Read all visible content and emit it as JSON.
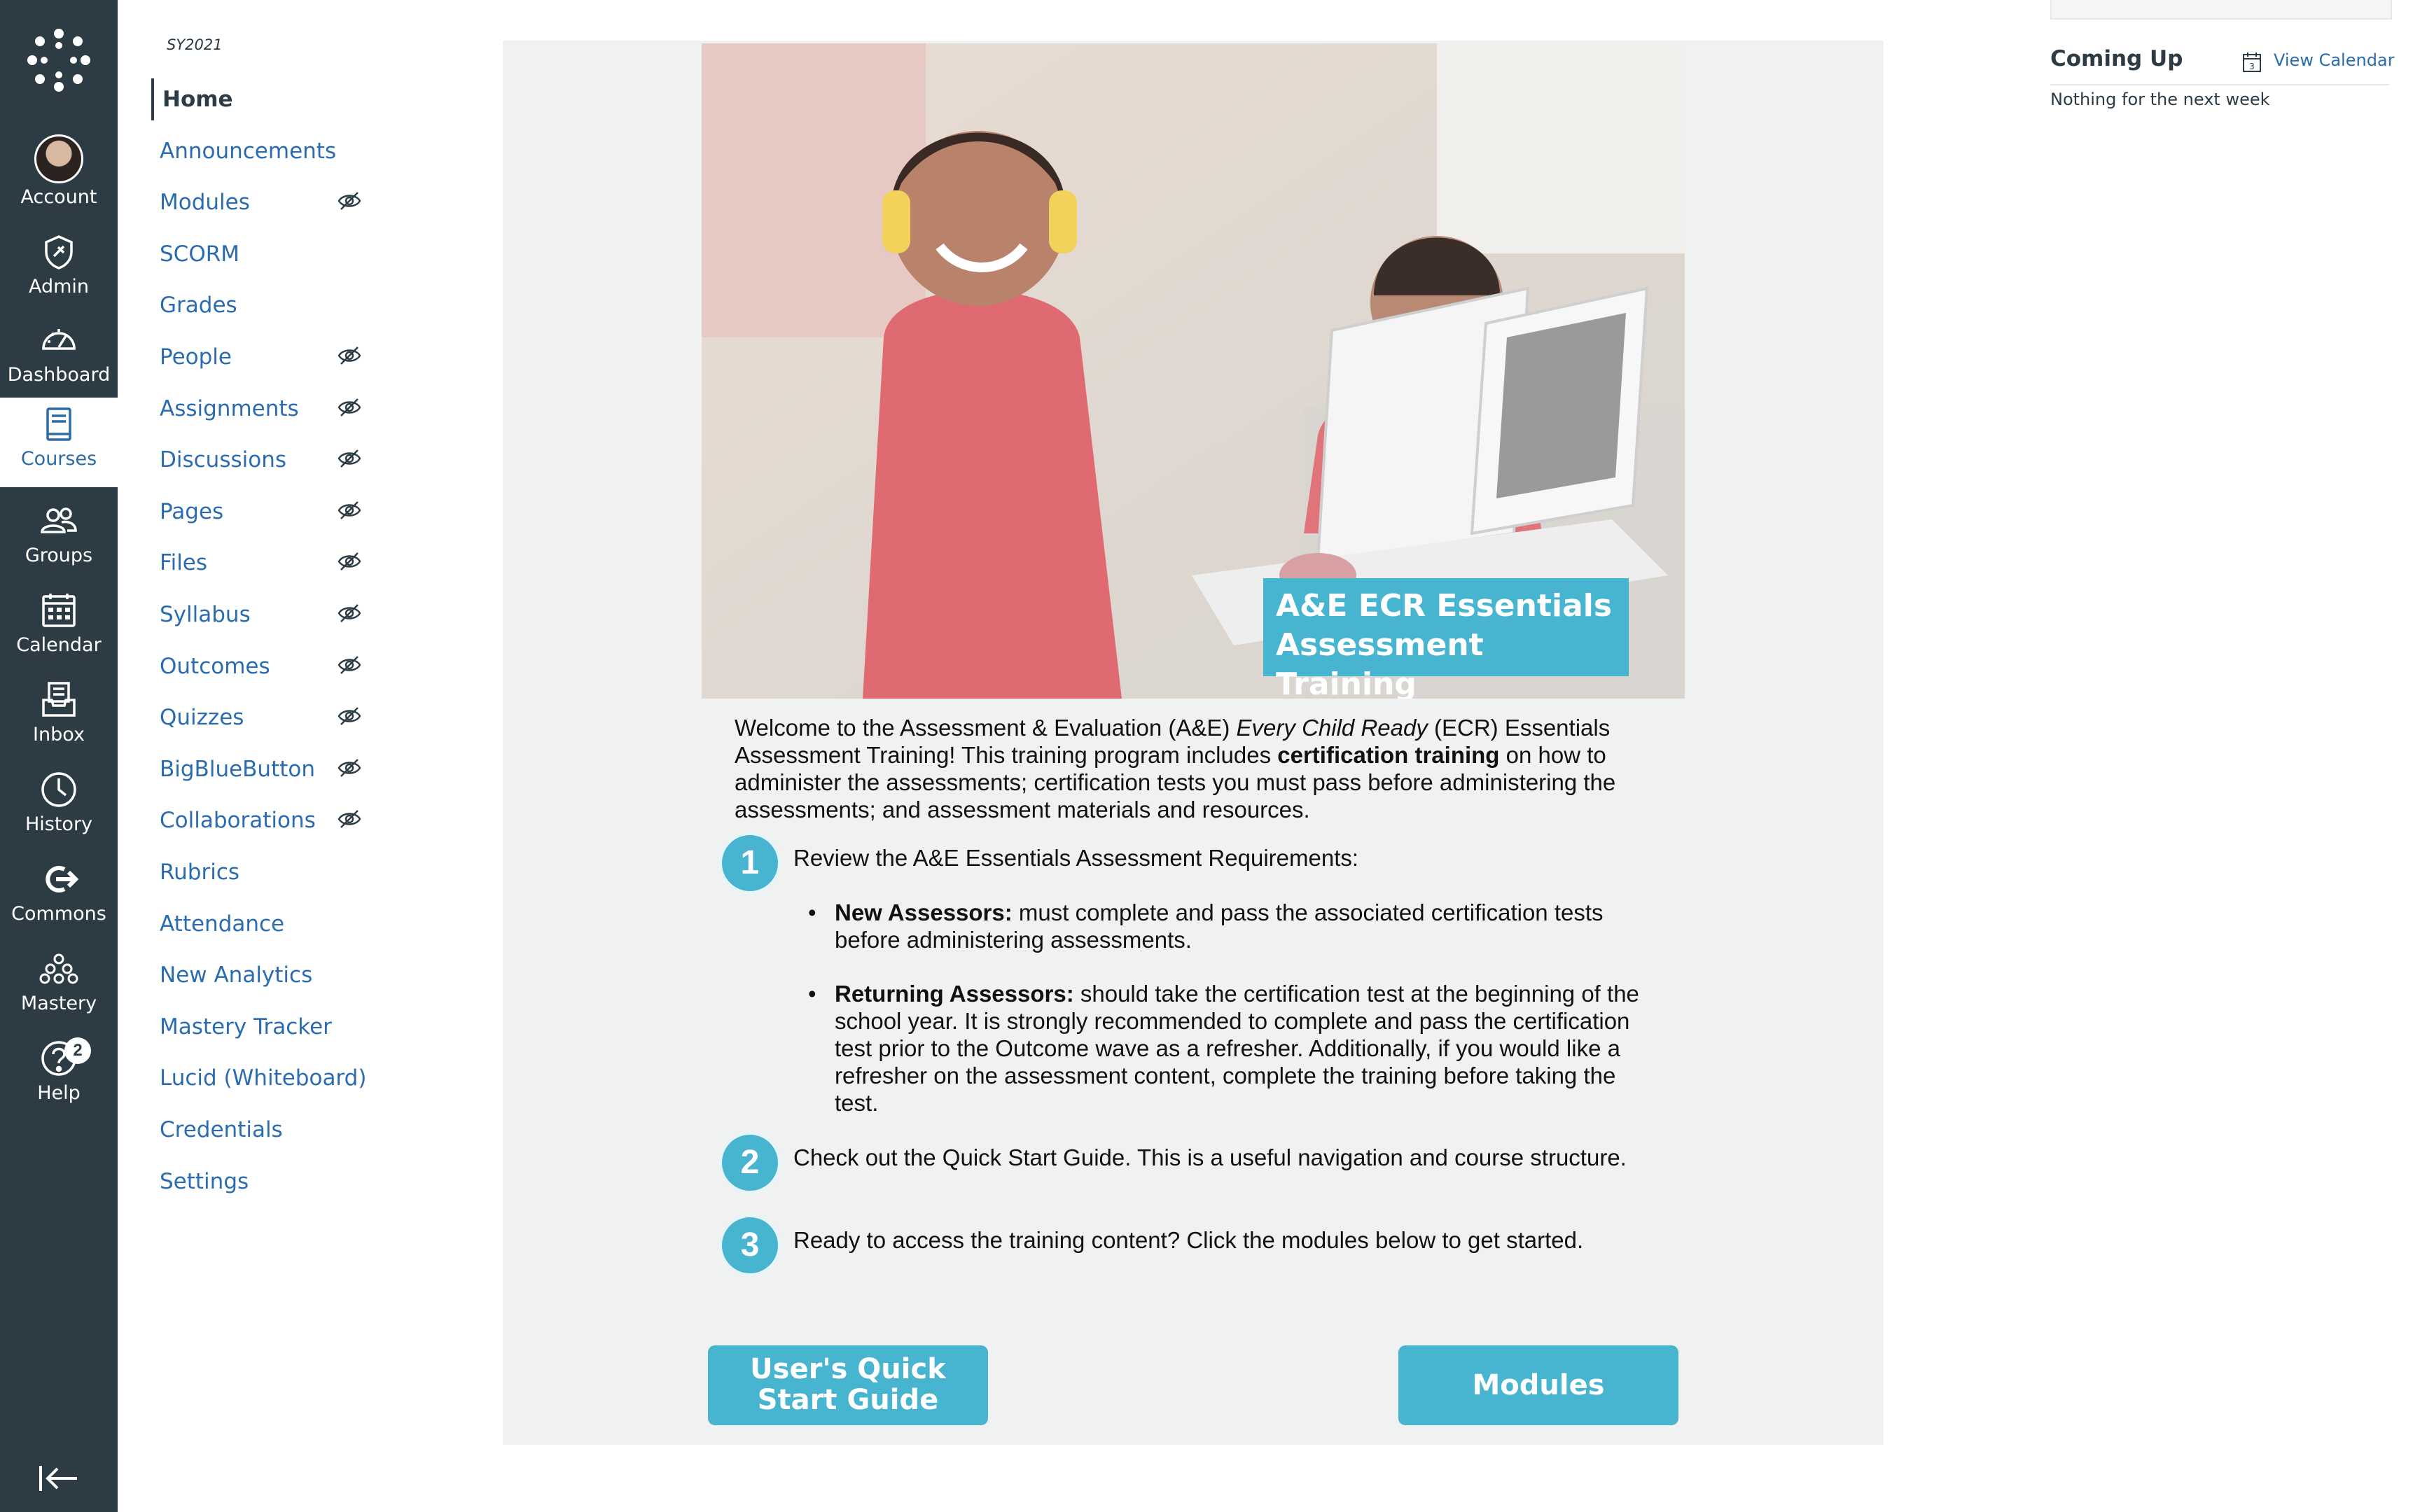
{
  "global_nav": {
    "items": [
      {
        "label": "Account",
        "icon": "account-avatar"
      },
      {
        "label": "Admin",
        "icon": "admin-shield-icon"
      },
      {
        "label": "Dashboard",
        "icon": "dashboard-gauge-icon"
      },
      {
        "label": "Courses",
        "icon": "courses-book-icon",
        "active": true
      },
      {
        "label": "Groups",
        "icon": "groups-icon"
      },
      {
        "label": "Calendar",
        "icon": "calendar-icon"
      },
      {
        "label": "Inbox",
        "icon": "inbox-icon"
      },
      {
        "label": "History",
        "icon": "history-clock-icon"
      },
      {
        "label": "Commons",
        "icon": "commons-icon"
      },
      {
        "label": "Mastery",
        "icon": "mastery-icon"
      },
      {
        "label": "Help",
        "icon": "help-icon",
        "badge": "2"
      }
    ]
  },
  "course_nav": {
    "term": "SY2021",
    "items": [
      {
        "label": "Home",
        "active": true,
        "hidden": false
      },
      {
        "label": "Announcements",
        "hidden": false
      },
      {
        "label": "Modules",
        "hidden": true
      },
      {
        "label": "SCORM",
        "hidden": false
      },
      {
        "label": "Grades",
        "hidden": false
      },
      {
        "label": "People",
        "hidden": true
      },
      {
        "label": "Assignments",
        "hidden": true
      },
      {
        "label": "Discussions",
        "hidden": true
      },
      {
        "label": "Pages",
        "hidden": true
      },
      {
        "label": "Files",
        "hidden": true
      },
      {
        "label": "Syllabus",
        "hidden": true
      },
      {
        "label": "Outcomes",
        "hidden": true
      },
      {
        "label": "Quizzes",
        "hidden": true
      },
      {
        "label": "BigBlueButton",
        "hidden": true
      },
      {
        "label": "Collaborations",
        "hidden": true
      },
      {
        "label": "Rubrics",
        "hidden": false
      },
      {
        "label": "Attendance",
        "hidden": false
      },
      {
        "label": "New Analytics",
        "hidden": false
      },
      {
        "label": "Mastery Tracker",
        "hidden": false
      },
      {
        "label": "Lucid (Whiteboard)",
        "hidden": false
      },
      {
        "label": "Credentials",
        "hidden": false
      },
      {
        "label": "Settings",
        "hidden": false
      }
    ]
  },
  "main": {
    "hero_banner": {
      "line1": "A&E ECR Essentials",
      "line2": "Assessment Training"
    },
    "intro": {
      "p1": "Welcome to the Assessment & Evaluation (A&E) ",
      "italic": "Every Child Ready",
      "p2": " (ECR) Essentials Assessment Training! This training program includes ",
      "bold": "certification training",
      "p3": " on how to administer the assessments; certification tests you must pass before administering the assessments; and assessment materials and resources."
    },
    "steps": [
      {
        "number": "1",
        "text": "Review the A&E Essentials Assessment Requirements:"
      },
      {
        "number": "2",
        "text": "Check out the Quick Start Guide. This is a useful navigation and course structure."
      },
      {
        "number": "3",
        "text": "Ready to access the training content? Click the modules below to get started."
      }
    ],
    "bullets": [
      {
        "bold": "New Assessors:",
        "text": " must complete and pass the associated certification tests before administering assessments."
      },
      {
        "bold": "Returning Assessors:",
        "text": " should take the certification test at the beginning of the school year. It is strongly recommended to complete and pass the certification test prior to the Outcome wave as a refresher. Additionally, if you would like a refresher on the assessment content, complete the training before taking the test."
      }
    ],
    "buttons": {
      "quick_start_line1": "User's Quick",
      "quick_start_line2": "Start Guide",
      "modules": "Modules"
    }
  },
  "coming_up": {
    "title": "Coming Up",
    "calendar_icon_number": "3",
    "view_calendar": "View Calendar",
    "empty": "Nothing for the next week"
  },
  "colors": {
    "nav_bg": "#2d3b45",
    "link": "#2b6cb0",
    "accent_teal": "#47b5cf",
    "content_bg": "#f0f2f2"
  }
}
